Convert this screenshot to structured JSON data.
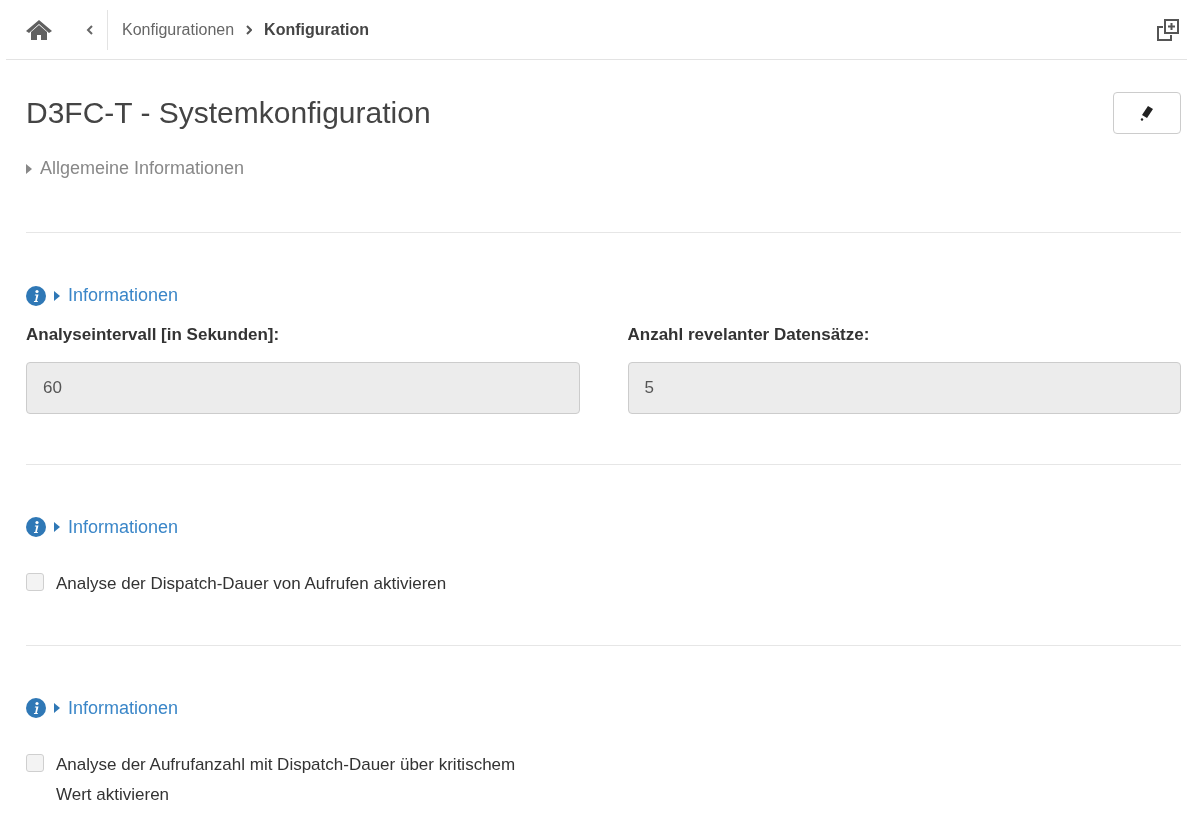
{
  "breadcrumb": {
    "items": [
      {
        "label": "Konfigurationen",
        "selected": false
      },
      {
        "label": "Konfiguration",
        "selected": true
      }
    ]
  },
  "title": "D3FC-T - Systemkonfiguration",
  "general_info": {
    "label": "Allgemeine Informationen",
    "expanded": false
  },
  "sections": [
    {
      "kind": "fields",
      "info": {
        "label": "Informationen",
        "expanded": false
      },
      "fields": [
        {
          "label": "Analyseintervall [in Sekunden]:",
          "value": "60",
          "disabled": true
        },
        {
          "label": "Anzahl revelanter Datensätze:",
          "value": "5",
          "disabled": true
        }
      ]
    },
    {
      "kind": "checkbox",
      "info": {
        "label": "Informationen",
        "expanded": false
      },
      "label": "Analyse der Dispatch-Dauer von Aufrufen aktivieren",
      "checked": false
    },
    {
      "kind": "checkbox",
      "info": {
        "label": "Informationen",
        "expanded": false
      },
      "label": "Analyse der Aufrufanzahl mit Dispatch-Dauer über kritischem Wert aktivieren",
      "checked": false
    }
  ]
}
